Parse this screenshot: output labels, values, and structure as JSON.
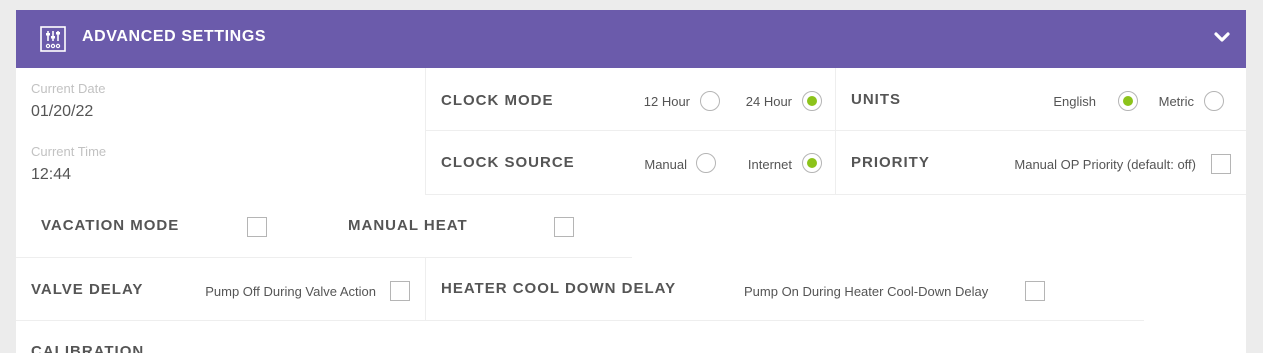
{
  "header": {
    "title": "ADVANCED SETTINGS",
    "icon": "sliders-icon",
    "toggle_icon": "chevron-down-icon",
    "color": "#6b5bab"
  },
  "current": {
    "date_label": "Current Date",
    "date_value": "01/20/22",
    "time_label": "Current Time",
    "time_value": "12:44"
  },
  "clock_mode": {
    "title": "CLOCK MODE",
    "options": [
      {
        "label": "12 Hour",
        "selected": false
      },
      {
        "label": "24 Hour",
        "selected": true
      }
    ]
  },
  "units": {
    "title": "UNITS",
    "options": [
      {
        "label": "English",
        "selected": true
      },
      {
        "label": "Metric",
        "selected": false
      }
    ]
  },
  "clock_source": {
    "title": "CLOCK SOURCE",
    "options": [
      {
        "label": "Manual",
        "selected": false
      },
      {
        "label": "Internet",
        "selected": true
      }
    ]
  },
  "priority": {
    "title": "PRIORITY",
    "option_label": "Manual OP Priority (default: off)",
    "checked": false
  },
  "vacation_mode": {
    "title": "VACATION MODE",
    "checked": false
  },
  "manual_heat": {
    "title": "MANUAL HEAT",
    "checked": false
  },
  "valve_delay": {
    "title": "VALVE DELAY",
    "option_label": "Pump Off During Valve Action",
    "checked": false
  },
  "heater_cool_down": {
    "title": "HEATER COOL DOWN DELAY",
    "option_label": "Pump On During Heater Cool-Down Delay",
    "checked": false
  },
  "calibration": {
    "title": "CALIBRATION"
  },
  "colors": {
    "accent": "#8cc31a",
    "header_bg": "#6b5bab"
  }
}
